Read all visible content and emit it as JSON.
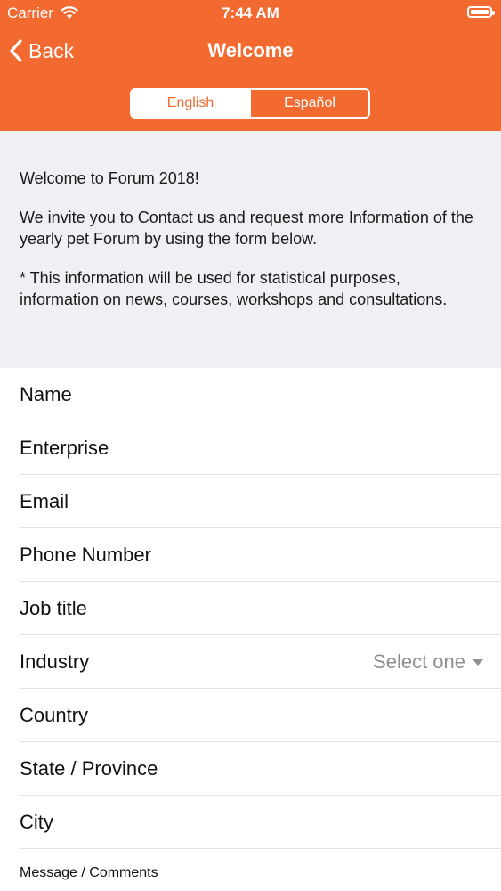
{
  "status_bar": {
    "carrier": "Carrier",
    "time": "7:44 AM"
  },
  "nav": {
    "back_label": "Back",
    "title": "Welcome"
  },
  "language_toggle": {
    "options": [
      "English",
      "Español"
    ],
    "selected": "English"
  },
  "intro": {
    "line1": "Welcome to Forum 2018!",
    "line2": "We invite you to Contact us and request more Information of the yearly pet Forum by using the form below.",
    "line3": "* This information will be used for statistical purposes, information on news, courses, workshops and consultations."
  },
  "form": {
    "fields": [
      "Name",
      "Enterprise",
      "Email",
      "Phone Number",
      "Job title",
      "Industry",
      "Country",
      "State / Province",
      "City"
    ],
    "industry_placeholder": "Select one",
    "message_label": "Message / Comments"
  },
  "colors": {
    "accent": "#f26a30",
    "section_bg": "#efeff4",
    "placeholder": "#8e8e93"
  }
}
